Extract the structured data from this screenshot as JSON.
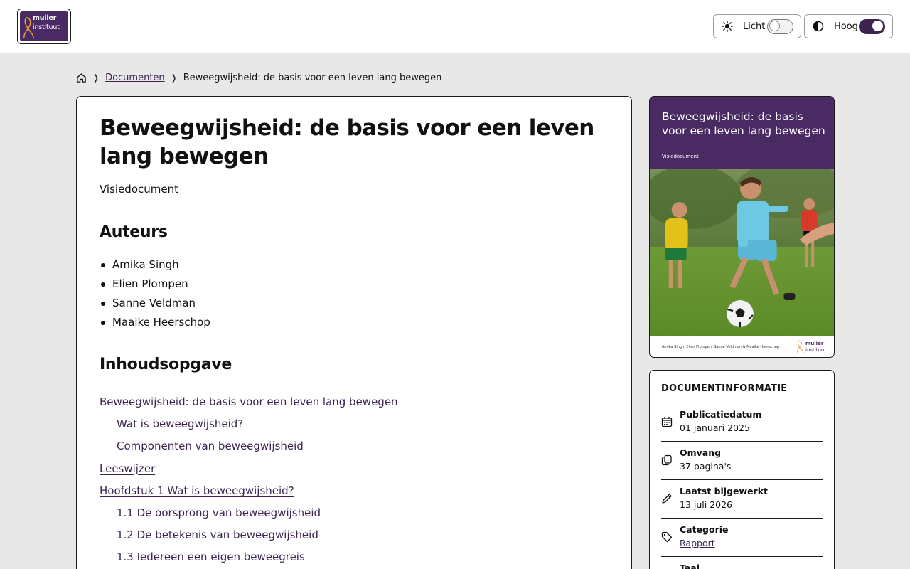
{
  "header": {
    "logo": {
      "line1": "mulier",
      "line2": "instituut"
    },
    "light_toggle": {
      "label": "Licht",
      "icon": "sun-icon",
      "state": "off"
    },
    "contrast_toggle": {
      "label": "Hoog",
      "icon": "contrast-icon",
      "state": "on"
    }
  },
  "breadcrumb": {
    "home_icon": "home-icon",
    "items": [
      "Documenten",
      "Beweegwijsheid: de basis voor een leven lang bewegen"
    ]
  },
  "document": {
    "title": "Beweegwijsheid: de basis voor een leven lang bewegen",
    "subtitle": "Visiedocument",
    "authors_heading": "Auteurs",
    "authors": [
      "Amika Singh",
      "Elien Plompen",
      "Sanne Veldman",
      "Maaike Heerschop"
    ],
    "toc_heading": "Inhoudsopgave",
    "toc": [
      {
        "label": "Beweegwijsheid: de basis voor een leven lang bewegen",
        "level": 1
      },
      {
        "label": "Wat is beweegwijsheid?",
        "level": 2
      },
      {
        "label": "Componenten van beweegwijsheid",
        "level": 2
      },
      {
        "label": "Leeswijzer",
        "level": 1
      },
      {
        "label": "Hoofdstuk 1 Wat is beweegwijsheid?",
        "level": 1
      },
      {
        "label": "1.1 De oorsprong van beweegwijsheid",
        "level": 2
      },
      {
        "label": "1.2 De betekenis van beweegwijsheid",
        "level": 2
      },
      {
        "label": "1.3 Iedereen een eigen beweegreis",
        "level": 2
      }
    ]
  },
  "cover": {
    "title": "Beweegwijsheid: de basis voor een leven lang bewegen",
    "type": "Visiedocument",
    "authors_line": "Amika Singh, Elien Plompen, Sanne Veldman & Maaike Heerschop",
    "logo_line1": "mulier",
    "logo_line2": "instituut"
  },
  "info": {
    "heading": "DOCUMENTINFORMATIE",
    "rows": [
      {
        "icon": "calendar-icon",
        "key": "Publicatiedatum",
        "value": "01 januari 2025"
      },
      {
        "icon": "copy-icon",
        "key": "Omvang",
        "value": "37 pagina's"
      },
      {
        "icon": "pencil-icon",
        "key": "Laatst bijgewerkt",
        "value": "13 juli 2026"
      },
      {
        "icon": "tag-icon",
        "key": "Categorie",
        "value": "Rapport"
      },
      {
        "icon": "language-icon",
        "key": "Taal",
        "value": ""
      }
    ]
  },
  "colors": {
    "brand": "#4a2a63",
    "link": "#3b2452",
    "background": "#e8e8e8"
  }
}
